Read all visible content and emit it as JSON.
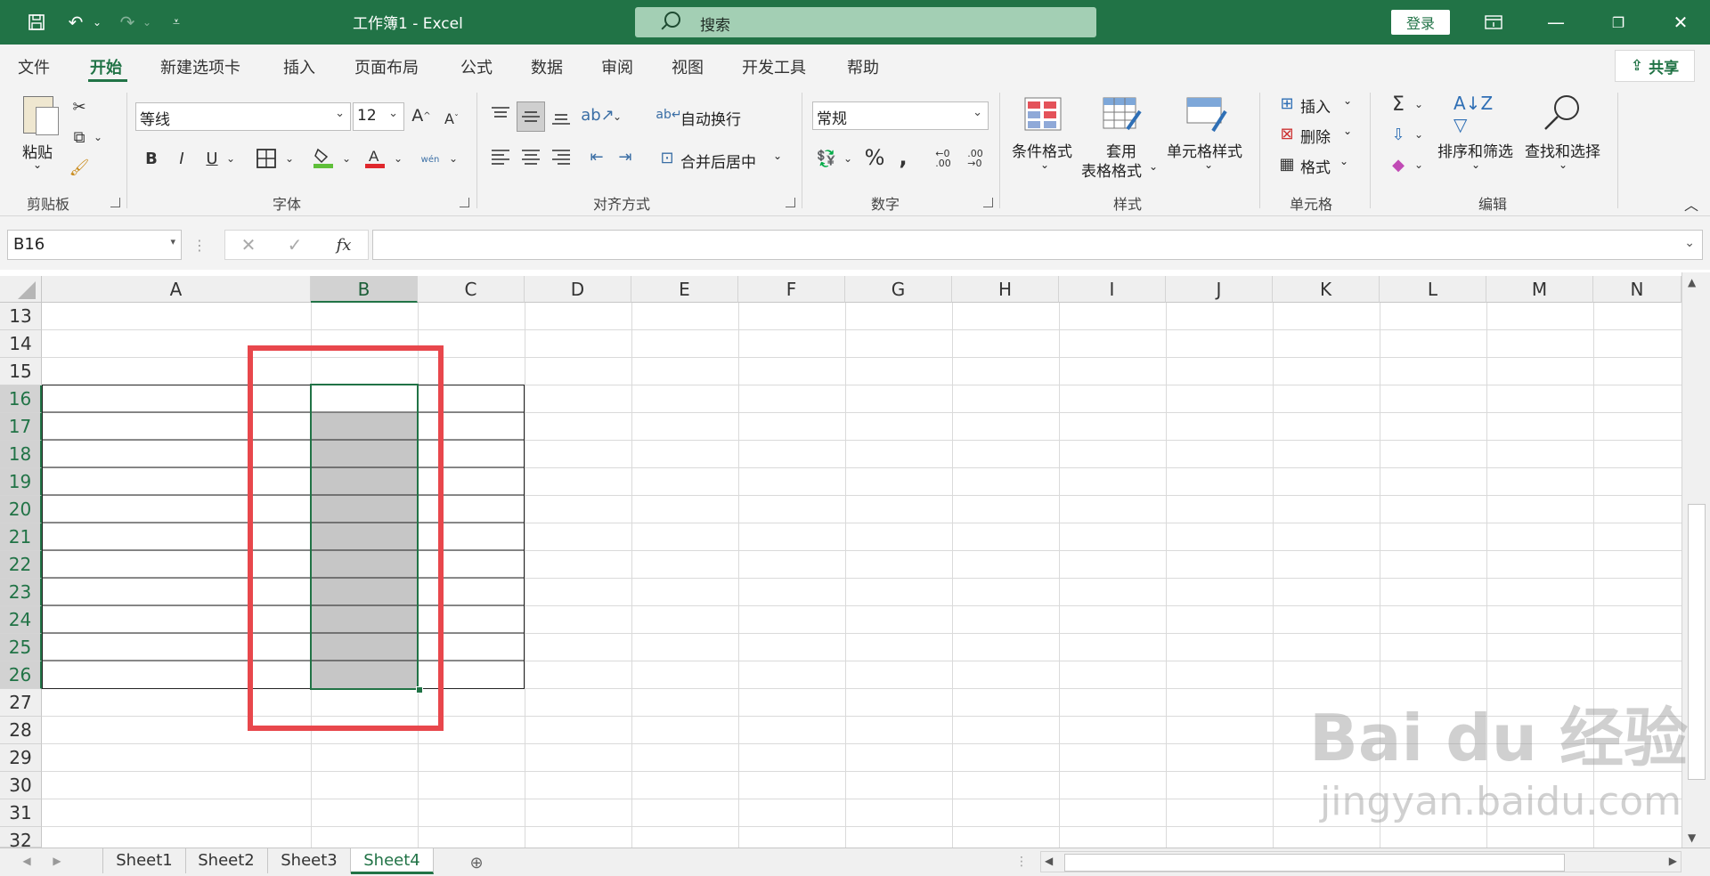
{
  "titlebar": {
    "doc_title": "工作簿1  -  Excel",
    "search_placeholder": "搜索",
    "login_label": "登录"
  },
  "menu": {
    "tabs": [
      "文件",
      "开始",
      "新建选项卡",
      "插入",
      "页面布局",
      "公式",
      "数据",
      "审阅",
      "视图",
      "开发工具",
      "帮助"
    ],
    "active_tab": "开始",
    "share_label": "共享"
  },
  "ribbon": {
    "clipboard": {
      "paste_label": "粘贴",
      "group_label": "剪贴板"
    },
    "font": {
      "font_name": "等线",
      "font_size": "12",
      "group_label": "字体",
      "bold": "B",
      "italic": "I",
      "underline": "U",
      "phonetic": "wén"
    },
    "alignment": {
      "wrap_label": "自动换行",
      "merge_label": "合并后居中",
      "group_label": "对齐方式"
    },
    "number": {
      "format": "常规",
      "group_label": "数字"
    },
    "styles": {
      "conditional_label": "条件格式",
      "table_label_1": "套用",
      "table_label_2": "表格格式",
      "cell_style_label": "单元格样式",
      "group_label": "样式"
    },
    "cells": {
      "insert_label": "插入",
      "delete_label": "删除",
      "format_label": "格式",
      "group_label": "单元格"
    },
    "editing": {
      "sort_label": "排序和筛选",
      "find_label": "查找和选择",
      "group_label": "编辑"
    }
  },
  "formula_bar": {
    "name_box": "B16",
    "fx_label": "fx",
    "formula": ""
  },
  "grid": {
    "columns": [
      "A",
      "B",
      "C",
      "D",
      "E",
      "F",
      "G",
      "H",
      "I",
      "J",
      "K",
      "L",
      "M",
      "N"
    ],
    "selected_column": "B",
    "rows": [
      "13",
      "14",
      "15",
      "16",
      "17",
      "18",
      "19",
      "20",
      "21",
      "22",
      "23",
      "24",
      "25",
      "26",
      "27",
      "28",
      "29",
      "30",
      "31",
      "32"
    ],
    "selected_rows": [
      "16",
      "17",
      "18",
      "19",
      "20",
      "21",
      "22",
      "23",
      "24",
      "25",
      "26"
    ],
    "active_cell": "B16",
    "selection_range": "B16:B26",
    "highlight_box_color": "#e8474c",
    "selection_fill": "#c6c6c6"
  },
  "sheets": {
    "tabs": [
      "Sheet1",
      "Sheet2",
      "Sheet3",
      "Sheet4"
    ],
    "active": "Sheet4"
  },
  "watermark": {
    "brand": "Bai du 经验",
    "url": "jingyan.baidu.com"
  },
  "colors": {
    "excel_green": "#217346",
    "ribbon_bg": "#f3f3f3"
  }
}
